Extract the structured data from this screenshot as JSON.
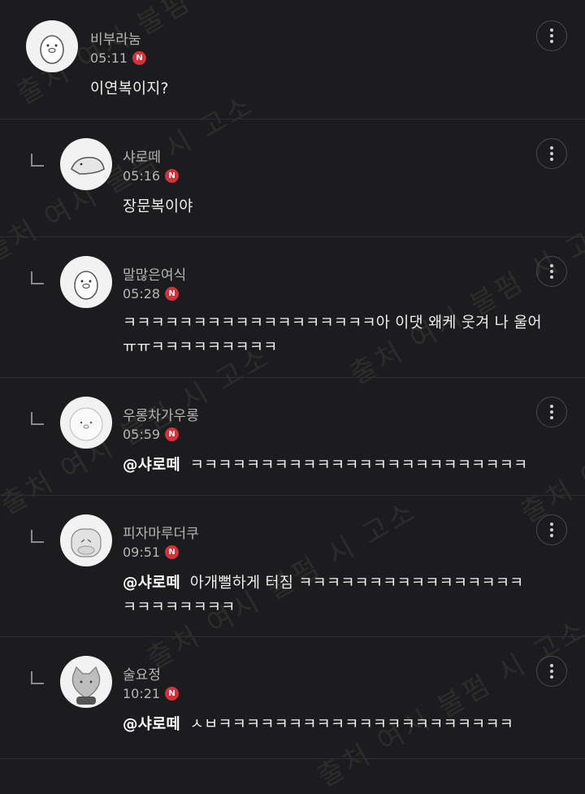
{
  "new_badge": "N",
  "watermark": "출처 여시 불펌 시 고소",
  "comments": [
    {
      "nick": "비부라눔",
      "time": "05:11",
      "text": "이연복이지?",
      "mention": ""
    },
    {
      "nick": "샤로떼",
      "time": "05:16",
      "text": "장문복이야",
      "mention": ""
    },
    {
      "nick": "말많은여식",
      "time": "05:28",
      "text": "ㅋㅋㅋㅋㅋㅋㅋㅋㅋㅋㅋㅋㅋㅋㅋㅋㅋㅋ아 이댓 왜케 웃겨 나 울어",
      "text2": "ㅠㅠㅋㅋㅋㅋㅋㅋㅋㅋㅋ",
      "mention": ""
    },
    {
      "nick": "우롱차가우롱",
      "time": "05:59",
      "mention": "@샤로떼",
      "text": "ㅋㅋㅋㅋㅋㅋㅋㅋㅋㅋㅋㅋㅋㅋㅋㅋㅋㅋㅋㅋㅋㅋㅋㅋ"
    },
    {
      "nick": "피자마루더쿠",
      "time": "09:51",
      "mention": "@샤로떼",
      "text": "아개뻘하게 터짐 ㅋㅋㅋㅋㅋㅋㅋㅋㅋㅋㅋㅋㅋㅋㅋㅋ",
      "text2": "ㅋㅋㅋㅋㅋㅋㅋㅋ"
    },
    {
      "nick": "술요정",
      "time": "10:21",
      "mention": "@샤로떼",
      "text": "ㅅㅂㅋㅋㅋㅋㅋㅋㅋㅋㅋㅋㅋㅋㅋㅋㅋㅋㅋㅋㅋㅋㅋ"
    }
  ]
}
